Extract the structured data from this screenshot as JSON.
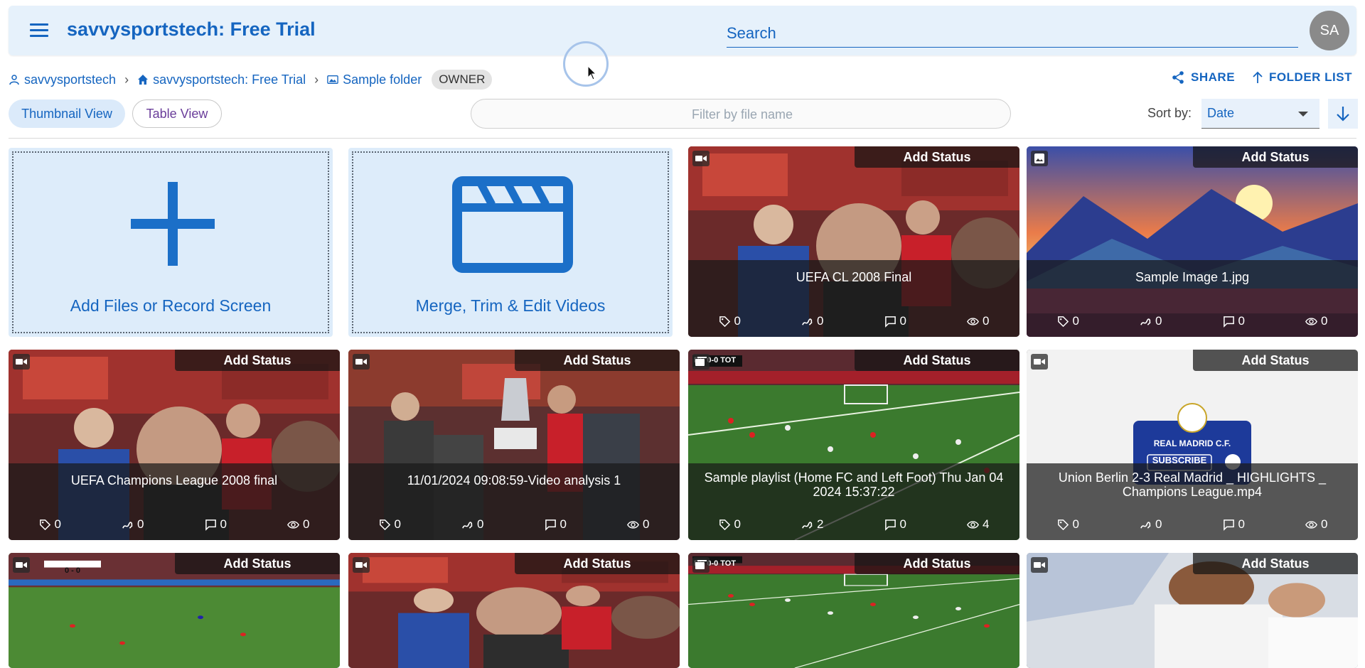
{
  "app": {
    "title": "savvysportstech: Free Trial",
    "avatar_initials": "SA"
  },
  "search": {
    "placeholder": "Search"
  },
  "breadcrumb": {
    "items": [
      "savvysportstech",
      "savvysportstech: Free Trial",
      "Sample folder"
    ],
    "role_badge": "OWNER"
  },
  "actions": {
    "share": "SHARE",
    "folder_list": "FOLDER LIST"
  },
  "views": {
    "thumbnail": "Thumbnail View",
    "table": "Table View"
  },
  "filter": {
    "placeholder": "Filter by file name"
  },
  "sort": {
    "label": "Sort by:",
    "value": "Date"
  },
  "tiles": {
    "add_files": "Add Files or Record Screen",
    "merge": "Merge, Trim & Edit Videos"
  },
  "status_label": "Add Status",
  "cards": [
    {
      "title": "UEFA CL 2008 Final",
      "type": "video",
      "tags": "0",
      "annotations": "0",
      "comments": "0",
      "views": "0"
    },
    {
      "title": "Sample Image 1.jpg",
      "type": "image",
      "tags": "0",
      "annotations": "0",
      "comments": "0",
      "views": "0"
    },
    {
      "title": "UEFA Champions League 2008 final",
      "type": "video",
      "tags": "0",
      "annotations": "0",
      "comments": "0",
      "views": "0"
    },
    {
      "title": "11/01/2024 09:08:59-Video analysis 1",
      "type": "video",
      "tags": "0",
      "annotations": "0",
      "comments": "0",
      "views": "0"
    },
    {
      "title": "Sample playlist (Home FC and Left Foot) Thu Jan 04 2024 15:37:22",
      "type": "playlist",
      "tags": "0",
      "annotations": "2",
      "comments": "0",
      "views": "4"
    },
    {
      "title": "Union Berlin 2-3 Real Madrid _ HIGHLIGHTS _ Champions League.mp4",
      "type": "video",
      "tags": "0",
      "annotations": "0",
      "comments": "0",
      "views": "0"
    },
    {
      "title": "",
      "type": "video"
    },
    {
      "title": "",
      "type": "video"
    },
    {
      "title": "",
      "type": "video"
    },
    {
      "title": "",
      "type": "video"
    }
  ],
  "thumbnail_overlays": {
    "real_madrid_label": "REAL MADRID C.F.",
    "subscribe_label": "SUBSCRIBE",
    "scoreboard": "RS 0-0 TOT",
    "scoreboard_2": "0 - 0"
  },
  "colors": {
    "brand": "#1565c0",
    "appbar": "#e6f1fb",
    "tile_bg": "#ddecfa"
  }
}
